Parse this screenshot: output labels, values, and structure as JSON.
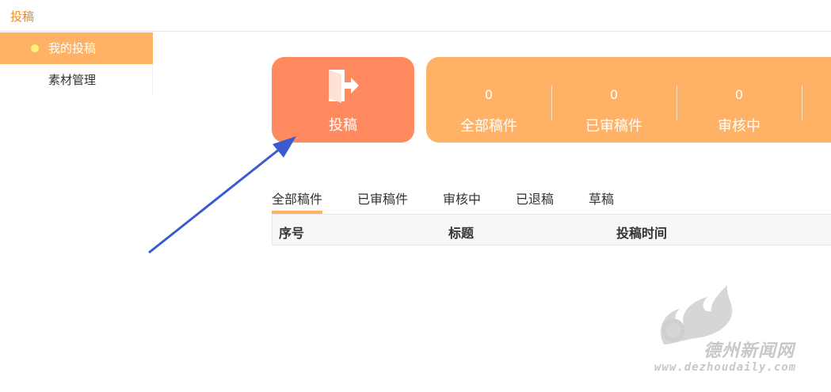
{
  "header": {
    "title": "投稿"
  },
  "sidebar": {
    "items": [
      {
        "label": "我的投稿",
        "active": true
      },
      {
        "label": "素材管理",
        "active": false
      }
    ]
  },
  "submit_card": {
    "label": "投稿",
    "icon": "door-exit-icon"
  },
  "stats": [
    {
      "value": "0",
      "label": "全部稿件"
    },
    {
      "value": "0",
      "label": "已审稿件"
    },
    {
      "value": "0",
      "label": "审核中"
    }
  ],
  "tabs": [
    {
      "label": "全部稿件",
      "active": true
    },
    {
      "label": "已审稿件",
      "active": false
    },
    {
      "label": "审核中",
      "active": false
    },
    {
      "label": "已退稿",
      "active": false
    },
    {
      "label": "草稿",
      "active": false
    }
  ],
  "table": {
    "columns": [
      "序号",
      "标题",
      "投稿时间"
    ]
  },
  "watermark": {
    "title": "德州新闻网",
    "url": "www.dezhoudaily.com"
  },
  "colors": {
    "accent_orange": "#f08a1c",
    "card_coral": "#ff8a5f",
    "card_peach": "#ffb265",
    "annotation_arrow": "#3a5bd0"
  }
}
